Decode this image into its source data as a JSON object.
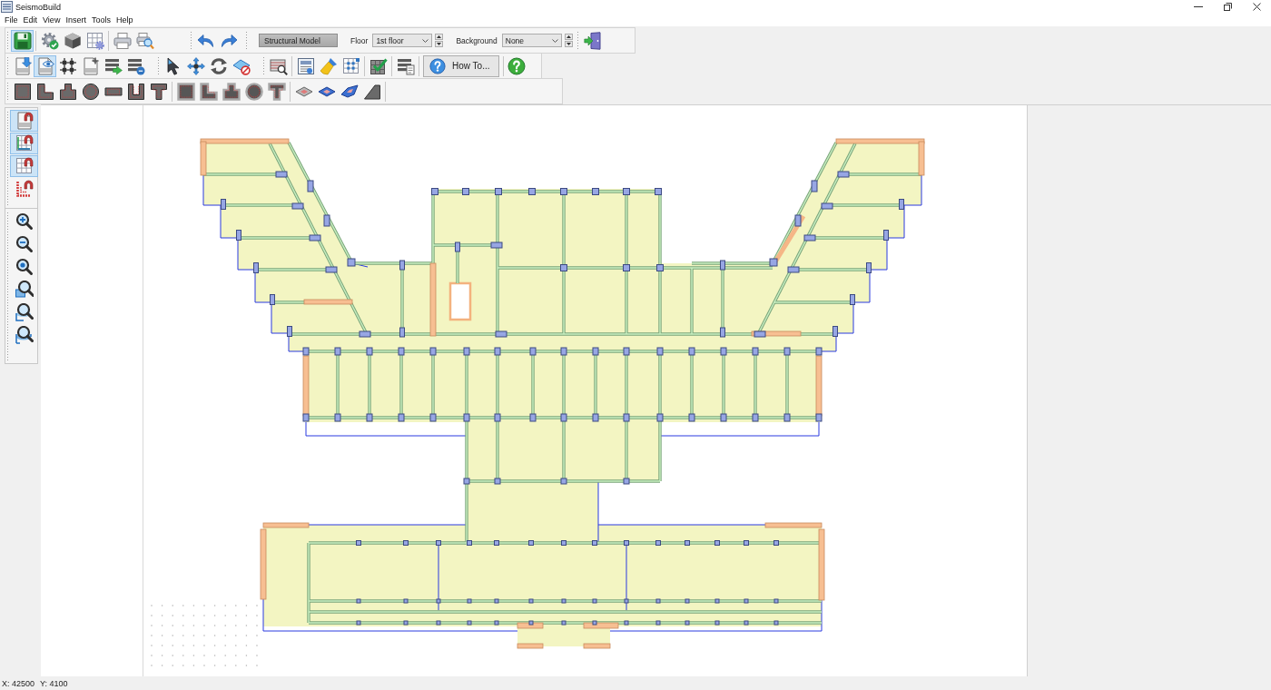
{
  "window": {
    "title": "SeismoBuild"
  },
  "menu": [
    "File",
    "Edit",
    "View",
    "Insert",
    "Tools",
    "Help"
  ],
  "toolbar_rows": [
    {
      "bands": [
        {
          "items": [
            {
              "kind": "icon",
              "selected": true
            },
            {
              "kind": "separator"
            },
            {
              "kind": "icon",
              "selected": false
            },
            {
              "kind": "icon",
              "selected": false
            },
            {
              "kind": "icon",
              "selected": false
            },
            {
              "kind": "separator"
            },
            {
              "kind": "icon",
              "selected": false
            },
            {
              "kind": "icon",
              "selected": false
            }
          ]
        },
        {
          "items": [
            {
              "kind": "icon",
              "selected": false
            },
            {
              "kind": "icon",
              "selected": false
            }
          ]
        },
        {
          "items": [
            {
              "kind": "text-button",
              "label": "Structural Model"
            },
            {
              "kind": "label",
              "text": "Floor"
            },
            {
              "kind": "select",
              "value": "1st floor"
            },
            {
              "kind": "label",
              "text": "Background"
            },
            {
              "kind": "select",
              "value": "None"
            }
          ]
        },
        {
          "items": [
            {
              "kind": "icon",
              "selected": false
            }
          ]
        }
      ]
    },
    {
      "bands": [
        {
          "items": [
            {
              "kind": "icon",
              "selected": false
            },
            {
              "kind": "icon",
              "selected": true
            },
            {
              "kind": "icon",
              "selected": false
            },
            {
              "kind": "icon",
              "selected": false
            },
            {
              "kind": "icon",
              "selected": false
            },
            {
              "kind": "icon",
              "selected": false
            }
          ]
        },
        {
          "items": [
            {
              "kind": "icon",
              "selected": false
            },
            {
              "kind": "icon",
              "selected": false
            },
            {
              "kind": "icon",
              "selected": false
            },
            {
              "kind": "icon",
              "selected": false
            }
          ]
        },
        {
          "items": [
            {
              "kind": "icon",
              "selected": false
            },
            {
              "kind": "separator"
            },
            {
              "kind": "icon",
              "selected": false
            },
            {
              "kind": "icon",
              "selected": false
            },
            {
              "kind": "icon",
              "selected": false
            },
            {
              "kind": "separator"
            },
            {
              "kind": "icon",
              "selected": false
            },
            {
              "kind": "separator"
            },
            {
              "kind": "icon",
              "selected": false
            },
            {
              "kind": "separator"
            },
            {
              "kind": "icon-text-button",
              "label": "How To..."
            },
            {
              "kind": "separator"
            },
            {
              "kind": "icon",
              "selected": false
            }
          ]
        }
      ]
    },
    {
      "bands": [
        {
          "items": [
            {
              "kind": "icon",
              "selected": false
            },
            {
              "kind": "icon",
              "selected": false
            },
            {
              "kind": "icon",
              "selected": false
            },
            {
              "kind": "icon",
              "selected": false
            },
            {
              "kind": "icon",
              "selected": false
            },
            {
              "kind": "icon",
              "selected": false
            },
            {
              "kind": "icon",
              "selected": false
            },
            {
              "kind": "separator"
            },
            {
              "kind": "icon",
              "selected": false
            },
            {
              "kind": "icon",
              "selected": false
            },
            {
              "kind": "icon",
              "selected": false
            },
            {
              "kind": "icon",
              "selected": false
            },
            {
              "kind": "icon",
              "selected": false
            },
            {
              "kind": "separator"
            },
            {
              "kind": "icon",
              "selected": false
            },
            {
              "kind": "icon",
              "selected": false
            },
            {
              "kind": "icon",
              "selected": false
            },
            {
              "kind": "icon",
              "selected": false
            },
            {
              "kind": "separator"
            }
          ]
        }
      ]
    }
  ],
  "side_toolbar": {
    "bands": [
      {
        "items": [
          {
            "kind": "icon",
            "selected": true
          },
          {
            "kind": "icon",
            "selected": true
          },
          {
            "kind": "icon",
            "selected": true
          },
          {
            "kind": "icon",
            "selected": false
          }
        ]
      },
      {
        "items": [
          {
            "kind": "icon",
            "selected": false
          },
          {
            "kind": "icon",
            "selected": false
          },
          {
            "kind": "icon",
            "selected": false
          },
          {
            "kind": "icon",
            "selected": false
          },
          {
            "kind": "icon",
            "selected": false
          },
          {
            "kind": "icon",
            "selected": false
          }
        ]
      }
    ]
  },
  "status_bar": {
    "x_coordinate": "X: 42500",
    "y_coordinate": "Y: 4100"
  }
}
